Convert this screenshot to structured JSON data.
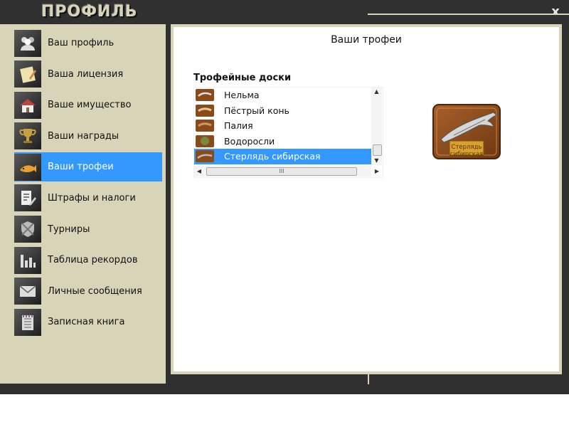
{
  "window": {
    "title": "ПРОФИЛЬ",
    "close_label": "x"
  },
  "sidebar": {
    "items": [
      {
        "label": "Ваш профиль",
        "icon": "users-icon"
      },
      {
        "label": "Ваша лицензия",
        "icon": "license-icon"
      },
      {
        "label": "Ваше имущество",
        "icon": "house-icon"
      },
      {
        "label": "Ваши награды",
        "icon": "trophy-icon"
      },
      {
        "label": "Ваши трофеи",
        "icon": "fish-trophy-icon",
        "active": true
      },
      {
        "label": "Штрафы и налоги",
        "icon": "document-edit-icon"
      },
      {
        "label": "Турниры",
        "icon": "tournament-shield-icon"
      },
      {
        "label": "Таблица рекордов",
        "icon": "bar-chart-icon"
      },
      {
        "label": "Личные сообщения",
        "icon": "envelope-icon"
      },
      {
        "label": "Записная книга",
        "icon": "notebook-icon"
      }
    ]
  },
  "main": {
    "title": "Ваши трофеи",
    "boards_title": "Трофейные доски",
    "boards": [
      {
        "label": "Нельма"
      },
      {
        "label": "Пёстрый конь"
      },
      {
        "label": "Палия"
      },
      {
        "label": "Водоросли"
      },
      {
        "label": "Стерлядь сибирская",
        "selected": true
      }
    ],
    "hscroll_grip": "III",
    "preview_label": "Стерлядь сибирская"
  },
  "colors": {
    "accent": "#3399ff",
    "frame": "#303030",
    "panel": "#d8d4b8",
    "wood": "#8b4a1a"
  }
}
